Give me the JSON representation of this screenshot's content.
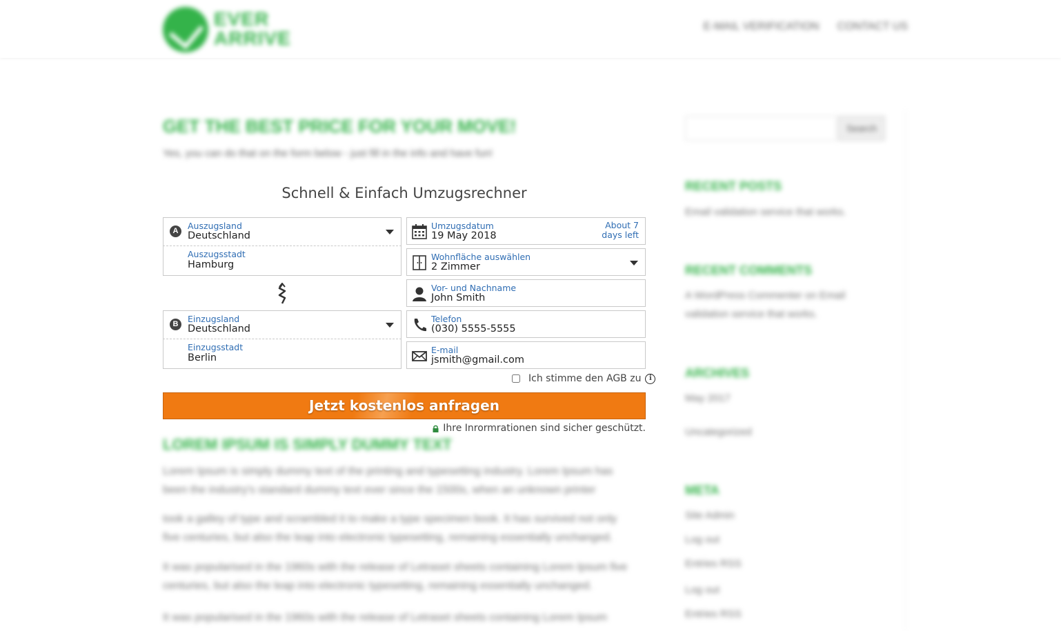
{
  "header": {
    "logo_line1": "EVER",
    "logo_line2": "ARRIVE",
    "nav": [
      "E-MAIL VERIFICATION",
      "CONTACT US"
    ]
  },
  "hero": {
    "title": "GET THE BEST PRICE FOR YOUR MOVE!",
    "subtitle": "Yes, you can do that on the form below - just fill in the info and have fun!"
  },
  "form": {
    "title": "Schnell & Einfach Umzugsrechner",
    "from_country": {
      "badge": "A",
      "label": "Auszugsland",
      "value": "Deutschland"
    },
    "from_city": {
      "label": "Auszugsstadt",
      "value": "Hamburg"
    },
    "to_country": {
      "badge": "B",
      "label": "Einzugsland",
      "value": "Deutschland"
    },
    "to_city": {
      "label": "Einzugsstadt",
      "value": "Berlin"
    },
    "date": {
      "label": "Umzugsdatum",
      "value": "19 May 2018",
      "days_left_1": "About 7",
      "days_left_2": "days left"
    },
    "area": {
      "label": "Wohnfläche auswählen",
      "value": "2 Zimmer"
    },
    "name": {
      "label": "Vor- und Nachname",
      "value": "John Smith"
    },
    "phone": {
      "label": "Telefon",
      "value": "(030) 5555-5555"
    },
    "email": {
      "label": "E-mail",
      "value": "jsmith@gmail.com"
    },
    "agb_label": "Ich stimme den AGB zu",
    "info_glyph": "i",
    "submit_label": "Jetzt kostenlos anfragen",
    "secure_note": "Ihre Inrormrationen sind sicher geschützt."
  },
  "content": {
    "title": "LOREM IPSUM IS SIMPLY DUMMY TEXT",
    "paragraphs": [
      "Lorem Ipsum is simply dummy text of the printing and typesetting industry. Lorem Ipsum has been the industry's standard dummy text ever since the 1500s, when an unknown printer",
      "took a galley of type and scrambled it to make a type specimen book. It has survived not only five centuries, but also the leap into electronic typesetting, remaining essentially unchanged.",
      "It was popularised in the 1960s with the release of Letraset sheets containing Lorem Ipsum five centuries, but also the leap into electronic typesetting, remaining essentially unchanged.",
      "It was popularised in the 1960s with the release of Letraset sheets containing Lorem Ipsum"
    ]
  },
  "sidebar": {
    "search_button": "Search",
    "recent_posts_title": "RECENT POSTS",
    "recent_posts": "Email validation service that works.",
    "recent_comments_title": "RECENT COMMENTS",
    "recent_comments": "A WordPress Commenter on Email validation service that works.",
    "archives_title": "ARCHIVES",
    "archives_item": "May 2017",
    "category_item": "Uncategorized",
    "meta_title": "META",
    "meta_items": [
      "Site Admin",
      "Log out",
      "Entries RSS",
      "Log out",
      "Entries RSS"
    ]
  },
  "colors": {
    "brand_green": "#34b34a",
    "accent_orange": "#f07a12",
    "label_blue": "#2f6db3"
  }
}
